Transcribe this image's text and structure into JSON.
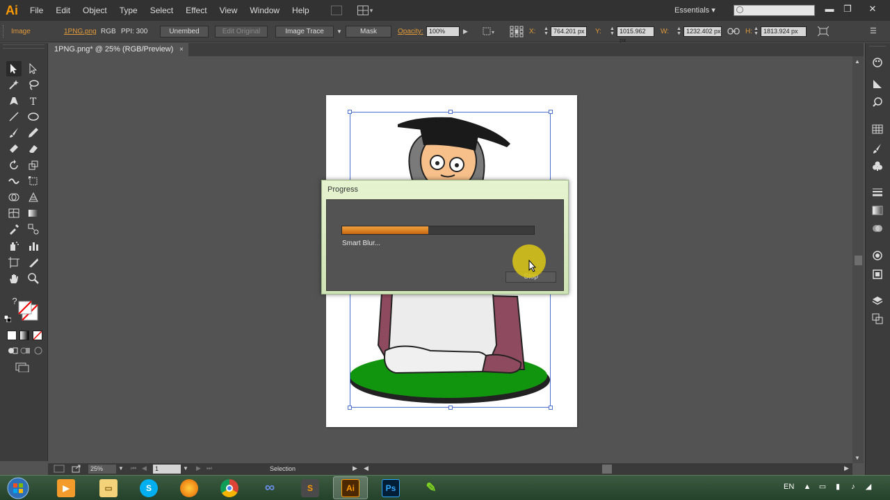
{
  "app": {
    "logo_text": "Ai",
    "accent_color": "#ff9a00"
  },
  "menu": {
    "items": [
      "File",
      "Edit",
      "Object",
      "Type",
      "Select",
      "Effect",
      "View",
      "Window",
      "Help"
    ],
    "workspace": "Essentials",
    "search_placeholder": ""
  },
  "controlbar": {
    "object_type": "Image",
    "file_name": "1PNG.png",
    "color_mode": "RGB",
    "ppi": "PPI: 300",
    "unembed": "Unembed",
    "edit_original": "Edit Original",
    "image_trace": "Image Trace",
    "mask": "Mask",
    "opacity_label": "Opacity:",
    "opacity_value": "100%",
    "x_label": "X:",
    "x_value": "764.201 px",
    "y_label": "Y:",
    "y_value": "1015.962 px",
    "w_label": "W:",
    "w_value": "1232.402 px",
    "h_label": "H:",
    "h_value": "1813.924 px"
  },
  "document": {
    "tab_title": "1PNG.png* @ 25% (RGB/Preview)",
    "close_glyph": "×"
  },
  "statusbar": {
    "zoom": "25%",
    "page": "1",
    "tool_status": "Selection"
  },
  "progress_dialog": {
    "title": "Progress",
    "message": "Smart Blur...",
    "progress_fraction": 0.45,
    "stop_label": "Stop",
    "bar_color": "#e08a2a"
  },
  "taskbar": {
    "apps": [
      "Windows Media Player",
      "File Explorer",
      "Skype",
      "Firefox",
      "Chrome",
      "Infinity",
      "Sublime Text",
      "Illustrator",
      "Photoshop",
      "App"
    ],
    "app_labels": {
      "skype": "S",
      "sublime": "S",
      "illustrator": "Ai",
      "photoshop": "Ps"
    },
    "language": "EN"
  }
}
